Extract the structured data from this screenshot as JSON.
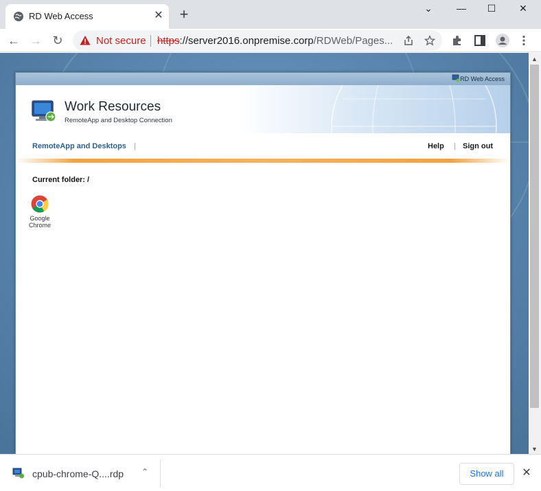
{
  "browser": {
    "tab_title": "RD Web Access",
    "tab_close": "✕",
    "new_tab": "+",
    "window_controls": {
      "minimize": "—",
      "maximize": "☐",
      "close": "✕",
      "tabsearch": "⌄"
    },
    "nav": {
      "back": "←",
      "forward": "→",
      "reload": "↻"
    },
    "security_label": "Not secure",
    "url_scheme": "https",
    "url_rest": "://server2016.onpremise.corp",
    "url_path": "/RDWeb/Pages..."
  },
  "rdweb": {
    "top_label": "RD Web Access",
    "title": "Work Resources",
    "subtitle": "RemoteApp and Desktop Connection",
    "nav_remoteapp": "RemoteApp and Desktops",
    "nav_sep": "|",
    "nav_help": "Help",
    "nav_signout": "Sign out",
    "current_folder": "Current folder: /",
    "apps": [
      {
        "label_line1": "Google",
        "label_line2": "Chrome",
        "icon": "chrome-icon"
      }
    ]
  },
  "download_shelf": {
    "file_name": "cpub-chrome-Q....rdp",
    "show_all": "Show all",
    "close": "✕",
    "chevron": "⌃"
  },
  "colors": {
    "tabstrip": "#dee1e6",
    "not_secure": "#c5221f",
    "link_blue": "#2e5f8e",
    "accent_orange": "#f2a340",
    "show_all_blue": "#1a73e8"
  }
}
